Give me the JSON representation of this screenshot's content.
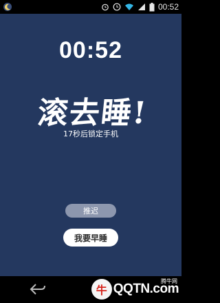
{
  "statusbar": {
    "time": "00:52",
    "left_icon": "moon-app-icon",
    "icons": [
      "alarm-icon",
      "clock-icon",
      "wifi-icon",
      "signal-icon",
      "battery-icon"
    ]
  },
  "main": {
    "clock": "00:52",
    "headline": "滚去睡!",
    "subtitle": "17秒后锁定手机",
    "delay_button": "推迟",
    "early_sleep_button": "我要早睡"
  },
  "navbar": {
    "back_icon": "back-arrow-icon"
  },
  "watermark": {
    "brand": "QQTN.com",
    "logo_text": "牛",
    "net_label": "腾牛网"
  },
  "colors": {
    "background": "#24385f",
    "delay_button": "#8d97ae",
    "early_button": "#ffffff"
  }
}
